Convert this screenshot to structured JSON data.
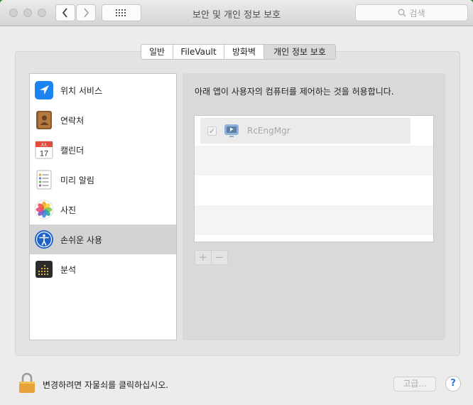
{
  "window": {
    "title": "보안 및 개인 정보 보호",
    "search_placeholder": "검색"
  },
  "tabs": [
    {
      "label": "일반",
      "active": false
    },
    {
      "label": "FileVault",
      "active": false
    },
    {
      "label": "방화벽",
      "active": false
    },
    {
      "label": "개인 정보 보호",
      "active": true
    }
  ],
  "sidebar": {
    "items": [
      {
        "label": "위치 서비스",
        "icon": "location-arrow-icon",
        "selected": false
      },
      {
        "label": "연락처",
        "icon": "contacts-book-icon",
        "selected": false
      },
      {
        "label": "캘린더",
        "icon": "calendar-icon",
        "selected": false
      },
      {
        "label": "미리 알림",
        "icon": "reminders-icon",
        "selected": false
      },
      {
        "label": "사진",
        "icon": "photos-icon",
        "selected": false
      },
      {
        "label": "손쉬운 사용",
        "icon": "accessibility-icon",
        "selected": true
      },
      {
        "label": "분석",
        "icon": "analytics-icon",
        "selected": false
      }
    ],
    "calendar": {
      "month": "JUL",
      "day": "17"
    }
  },
  "content": {
    "description": "아래 앱이 사용자의 컴퓨터를 제어하는 것을 허용합니다.",
    "apps": [
      {
        "name": "RcEngMgr",
        "checked": true,
        "icon": "remote-app-icon"
      }
    ],
    "add_label": "+",
    "remove_label": "−"
  },
  "footer": {
    "lock_label": "변경하려면 자물쇠를 클릭하십시오.",
    "advanced_label": "고급...",
    "help_label": "?"
  },
  "colors": {
    "accent": "#2a72e3",
    "selected_row": "#d3d3d3",
    "desktop": "#3c7a3c"
  }
}
